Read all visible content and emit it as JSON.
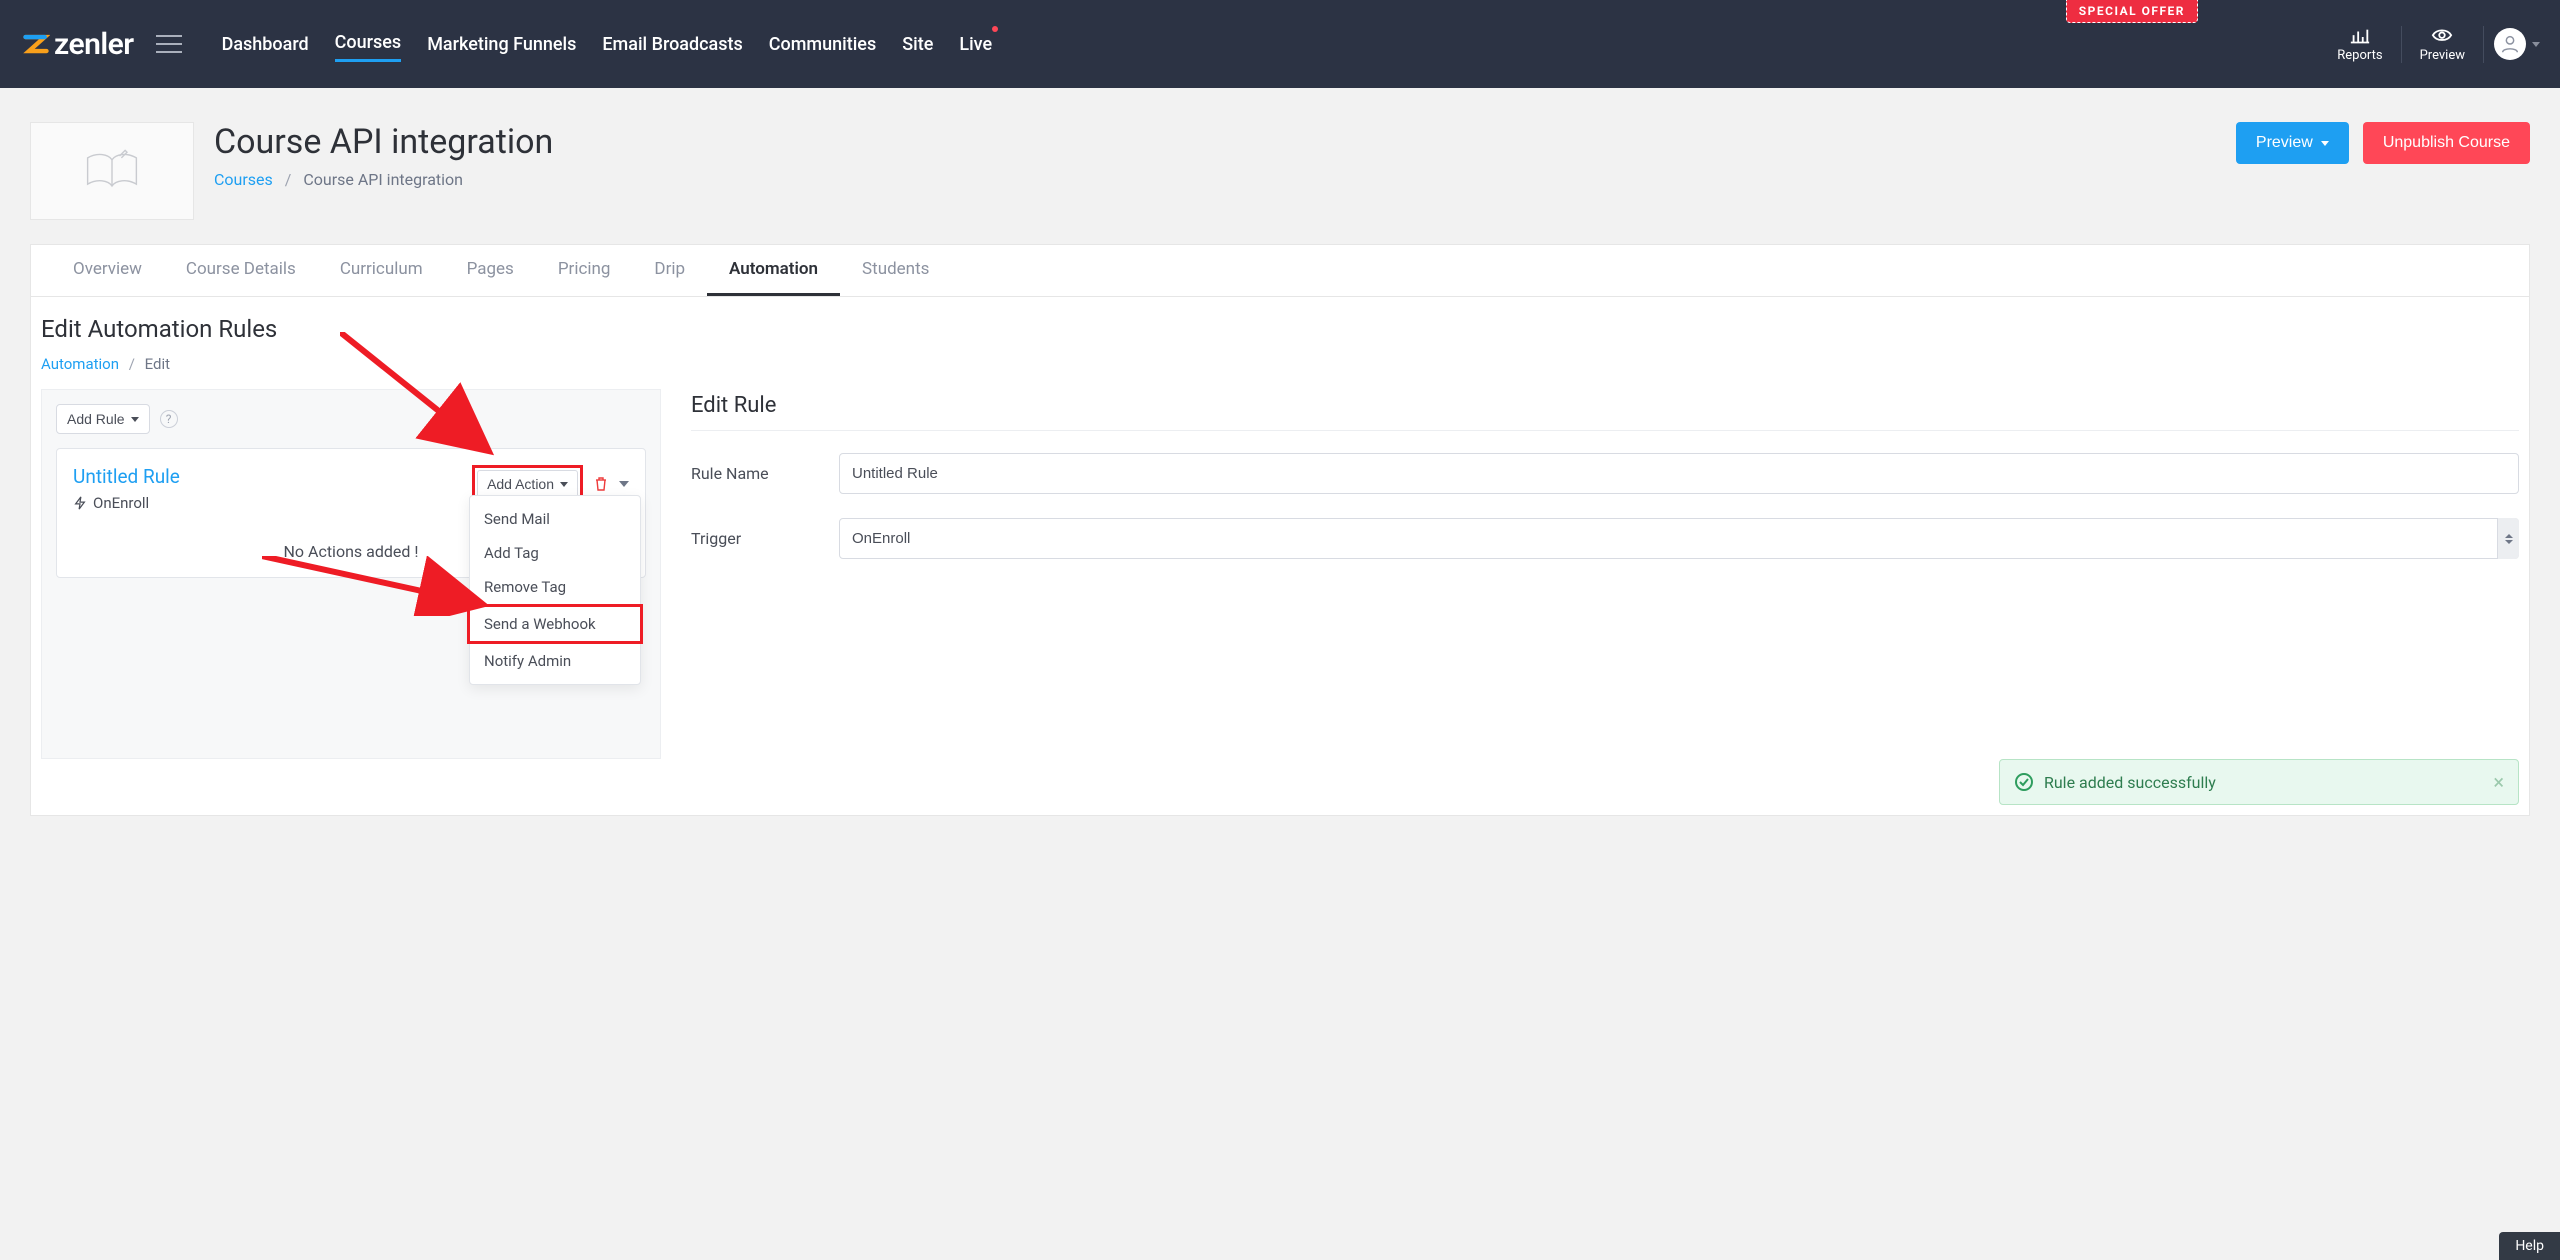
{
  "special_offer": "SPECIAL OFFER",
  "brand": "zenler",
  "nav": {
    "items": [
      "Dashboard",
      "Courses",
      "Marketing Funnels",
      "Email Broadcasts",
      "Communities",
      "Site",
      "Live"
    ],
    "active": "Courses",
    "reports": "Reports",
    "preview": "Preview"
  },
  "page": {
    "title": "Course API integration",
    "breadcrumb_root": "Courses",
    "breadcrumb_current": "Course API integration",
    "preview_btn": "Preview",
    "unpublish_btn": "Unpublish Course"
  },
  "tabs": {
    "items": [
      "Overview",
      "Course Details",
      "Curriculum",
      "Pages",
      "Pricing",
      "Drip",
      "Automation",
      "Students"
    ],
    "active": "Automation"
  },
  "content": {
    "title": "Edit Automation Rules",
    "bc_root": "Automation",
    "bc_current": "Edit",
    "add_rule": "Add Rule",
    "rule_name": "Untitled Rule",
    "rule_trigger": "OnEnroll",
    "add_action": "Add Action",
    "no_actions": "No Actions added !",
    "dropdown_items": [
      "Send Mail",
      "Add Tag",
      "Remove Tag",
      "Send a Webhook",
      "Notify Admin"
    ]
  },
  "edit_rule": {
    "title": "Edit Rule",
    "name_label": "Rule Name",
    "name_value": "Untitled Rule",
    "trigger_label": "Trigger",
    "trigger_value": "OnEnroll"
  },
  "toast_text": "Rule added successfully",
  "help": "Help"
}
